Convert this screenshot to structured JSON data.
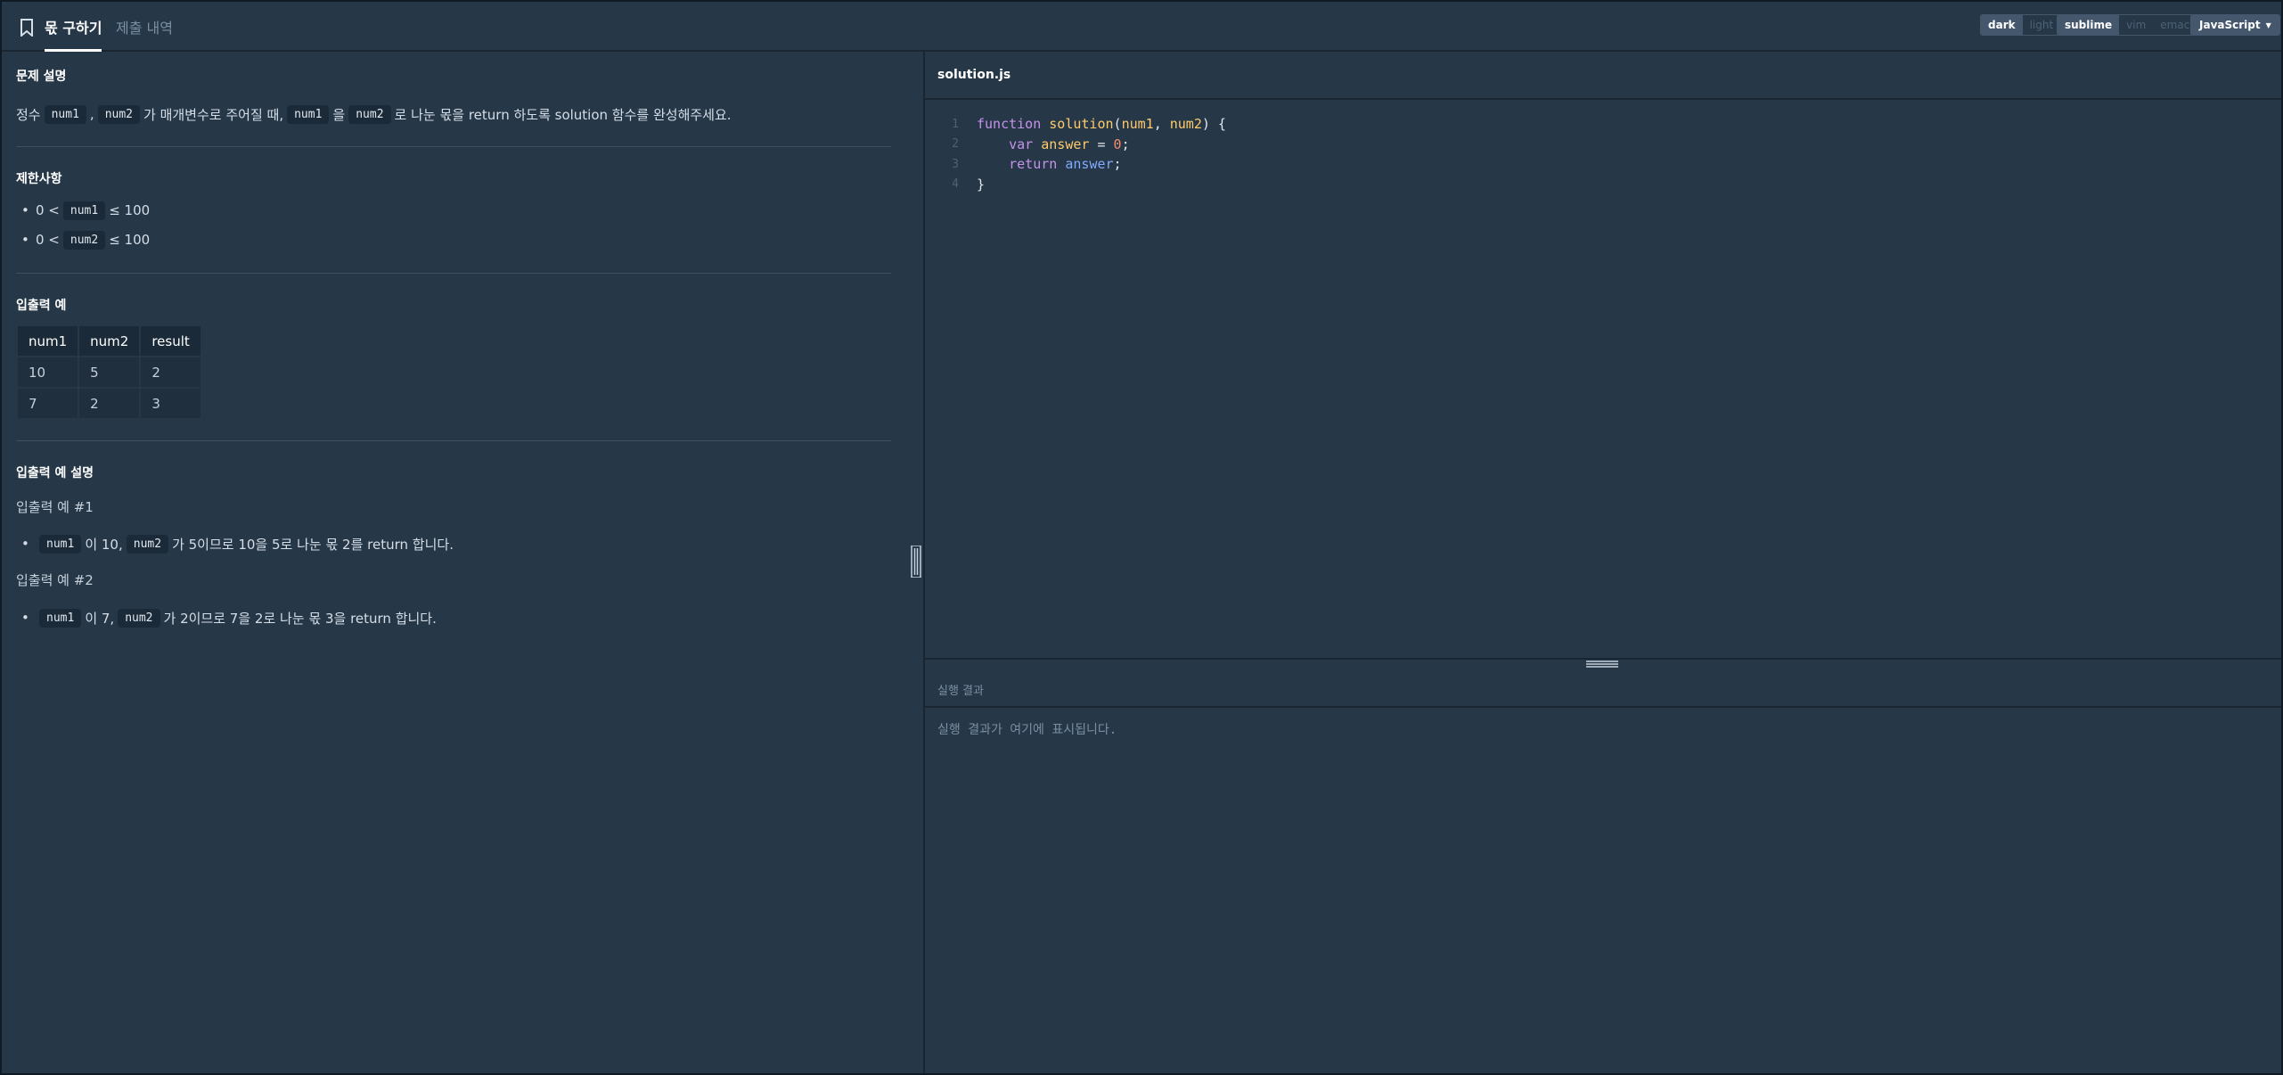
{
  "header": {
    "tabs": [
      {
        "label": "몫 구하기",
        "active": true
      },
      {
        "label": "제출 내역",
        "active": false
      }
    ],
    "theme_options": [
      "dark",
      "light"
    ],
    "theme_selected": "dark",
    "keymap_options": [
      "sublime",
      "vim",
      "emacs"
    ],
    "keymap_selected": "sublime",
    "language": "JavaScript"
  },
  "problem": {
    "title": "문제 설명",
    "desc_1": "정수",
    "desc_code_1": "num1",
    "desc_2": ",",
    "desc_code_2": "num2",
    "desc_3": "가 매개변수로 주어질 때,",
    "desc_code_3": "num1",
    "desc_4": "을",
    "desc_code_4": "num2",
    "desc_5": "로 나눈 몫을 return 하도록 solution 함수를 완성해주세요."
  },
  "constraints": {
    "title": "제한사항",
    "items": [
      {
        "prefix": "0 <",
        "code": "num1",
        "suffix": "≤ 100"
      },
      {
        "prefix": "0 <",
        "code": "num2",
        "suffix": "≤ 100"
      }
    ]
  },
  "examples": {
    "title": "입출력 예",
    "headers": [
      "num1",
      "num2",
      "result"
    ],
    "rows": [
      [
        "10",
        "5",
        "2"
      ],
      [
        "7",
        "2",
        "3"
      ]
    ]
  },
  "explanation": {
    "title": "입출력 예 설명",
    "ex1_title": "입출력 예 #1",
    "ex1": {
      "code1": "num1",
      "t1": "이 10,",
      "code2": "num2",
      "t2": "가 5이므로 10을 5로 나눈 몫 2를 return 합니다."
    },
    "ex2_title": "입출력 예 #2",
    "ex2": {
      "code1": "num1",
      "t1": "이 7,",
      "code2": "num2",
      "t2": "가 2이므로 7을 2로 나눈 몫 3을 return 합니다."
    }
  },
  "editor": {
    "filename": "solution.js",
    "line_numbers": [
      "1",
      "2",
      "3",
      "4"
    ],
    "code": {
      "l1_kw": "function",
      "l1_fn": "solution",
      "l1_open": "(",
      "l1_p1": "num1",
      "l1_comma": ", ",
      "l1_p2": "num2",
      "l1_close": ") {",
      "l2_kw": "var",
      "l2_id": "answer",
      "l2_eq": " = ",
      "l2_num": "0",
      "l2_semi": ";",
      "l3_kw": "return",
      "l3_id": "answer",
      "l3_semi": ";",
      "l4": "}"
    }
  },
  "result": {
    "title": "실행 결과",
    "placeholder": "실행 결과가 여기에 표시됩니다."
  }
}
